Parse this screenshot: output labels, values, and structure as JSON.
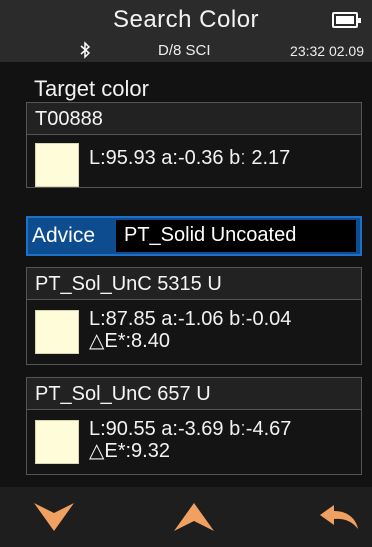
{
  "header": {
    "title": "Search Color",
    "battery_icon": "battery-full-icon"
  },
  "status": {
    "bluetooth_icon": "bluetooth-icon",
    "mode": "D/8  SCI",
    "time": "23:32 02.09"
  },
  "target": {
    "label": "Target color",
    "name": "T00888",
    "lab": "L:95.93 a:-0.36 bː 2.17",
    "swatch_color": "#fffcd9"
  },
  "advice": {
    "label": "Advice",
    "value": "PT_Solid Uncoated",
    "accent": "#0d4c8e"
  },
  "results": [
    {
      "name": "PT_Sol_UnC 5315 U",
      "lab": "L:87.85 a:-1.06 bː-0.04",
      "de": "△E*:8.40",
      "swatch_color": "#fffcd9"
    },
    {
      "name": "PT_Sol_UnC 657 U",
      "lab": "L:90.55 a:-3.69 bː-4.67",
      "de": "△E*:9.32",
      "swatch_color": "#fffcd9"
    }
  ],
  "footer": {
    "down_icon": "arrow-down-icon",
    "up_icon": "arrow-up-icon",
    "back_icon": "return-icon",
    "icon_color": "#f0a060"
  }
}
